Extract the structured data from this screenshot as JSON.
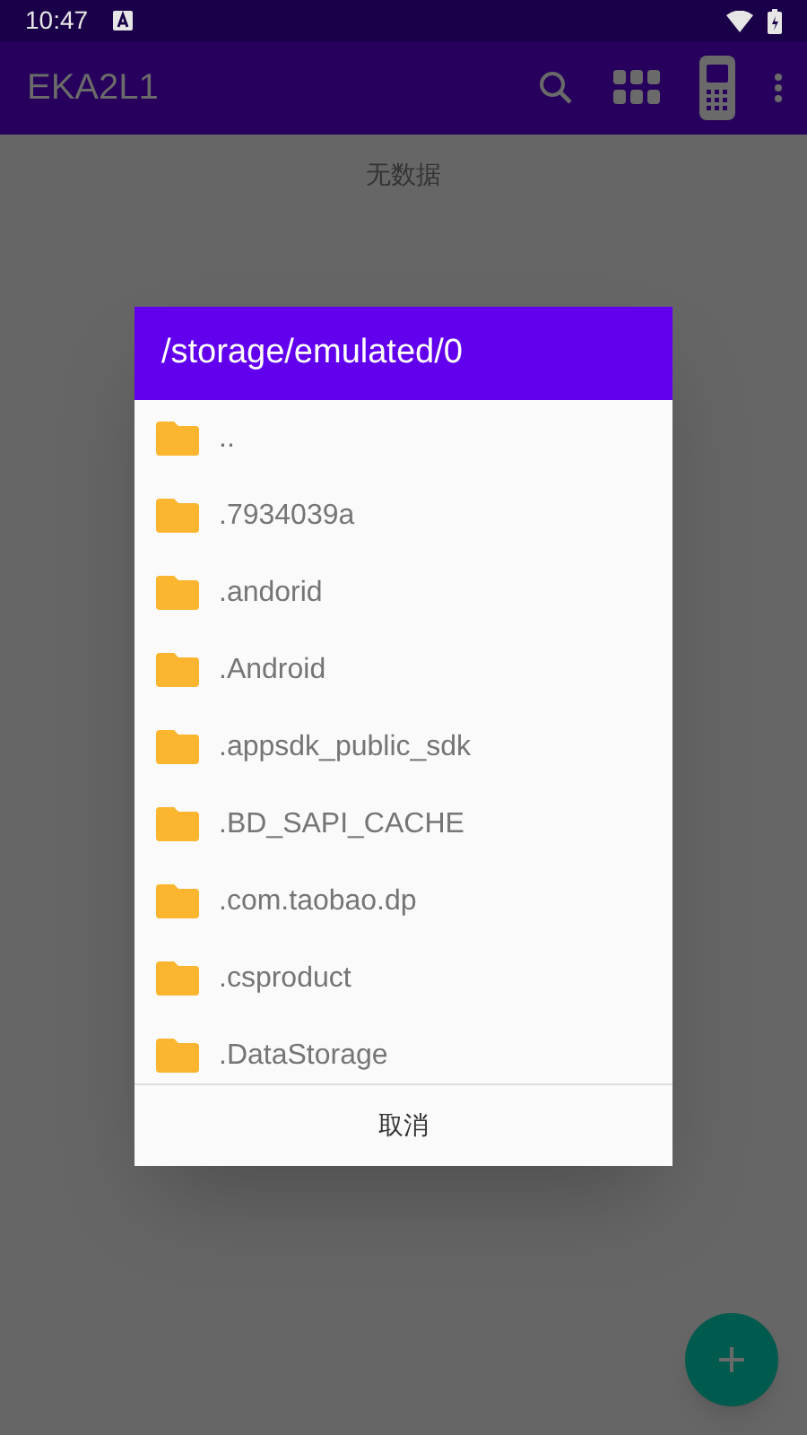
{
  "status_bar": {
    "time": "10:47"
  },
  "app_bar": {
    "title": "EKA2L1"
  },
  "content": {
    "empty_text": "无数据"
  },
  "dialog": {
    "title": "/storage/emulated/0",
    "items": [
      {
        "name": ".."
      },
      {
        "name": ".7934039a"
      },
      {
        "name": ".andorid"
      },
      {
        "name": ".Android"
      },
      {
        "name": ".appsdk_public_sdk"
      },
      {
        "name": ".BD_SAPI_CACHE"
      },
      {
        "name": ".com.taobao.dp"
      },
      {
        "name": ".csproduct"
      },
      {
        "name": ".DataStorage"
      }
    ],
    "cancel": "取消"
  }
}
